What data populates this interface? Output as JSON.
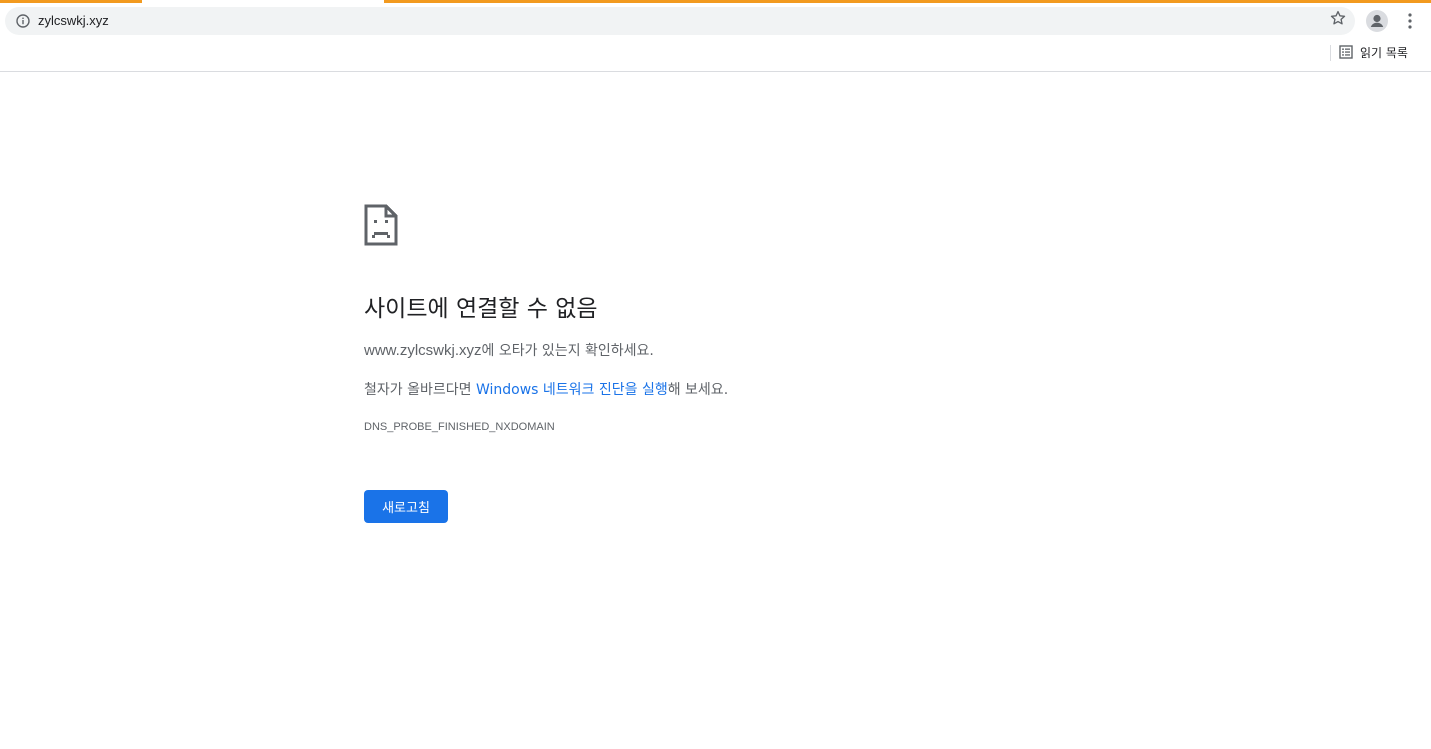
{
  "browser": {
    "url": "zylcswkj.xyz",
    "reading_list_label": "읽기 목록",
    "accent_color": "#f29a1f"
  },
  "error_page": {
    "title": "사이트에 연결할 수 없음",
    "line1_domain": "www.zylcswkj.xyz",
    "line1_suffix": "에 오타가 있는지 확인하세요.",
    "line2_prefix": "철자가 올바르다면 ",
    "line2_link": "Windows 네트워크 진단을 실행",
    "line2_suffix": "해 보세요.",
    "error_code": "DNS_PROBE_FINISHED_NXDOMAIN",
    "reload_label": "새로고침",
    "link_color": "#1a73e8",
    "button_color": "#1a73e8"
  },
  "icons": {
    "site_info": "info-icon",
    "bookmark": "star-icon",
    "profile": "profile-icon",
    "menu": "kebab-menu-icon",
    "reading_list": "reading-list-icon",
    "error": "sad-page-icon"
  }
}
